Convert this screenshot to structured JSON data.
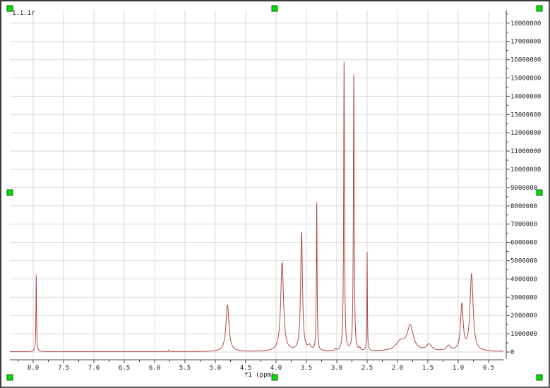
{
  "chart_data": {
    "type": "line",
    "title": "1.1.1r",
    "xlabel": "f1 (ppm)",
    "ylabel": "",
    "xlim": [
      8.38,
      0.26
    ],
    "ylim": [
      -400000,
      18600000
    ],
    "x_ticks": [
      "8.0",
      "7.5",
      "7.0",
      "6.5",
      "6.0",
      "5.5",
      "5.0",
      "4.5",
      "4.0",
      "3.5",
      "3.0",
      "2.5",
      "2.0",
      "1.5",
      "1.0",
      "0.5"
    ],
    "y_ticks": [
      "0",
      "1000000",
      "2000000",
      "3000000",
      "4000000",
      "5000000",
      "6000000",
      "7000000",
      "8000000",
      "9000000",
      "10000000",
      "11000000",
      "12000000",
      "13000000",
      "14000000",
      "15000000",
      "16000000",
      "17000000",
      "18000000"
    ],
    "grid": true,
    "line_color": "#b04848",
    "peaks": [
      {
        "ppm": 7.95,
        "height": 4200000,
        "width": 0.006
      },
      {
        "ppm": 5.77,
        "height": 80000,
        "width": 0.005
      },
      {
        "ppm": 4.8,
        "height": 2550000,
        "width": 0.03
      },
      {
        "ppm": 3.9,
        "height": 4850000,
        "width": 0.028
      },
      {
        "ppm": 3.58,
        "height": 6500000,
        "width": 0.018
      },
      {
        "ppm": 3.45,
        "height": 250000,
        "width": 0.03
      },
      {
        "ppm": 3.33,
        "height": 8100000,
        "width": 0.007
      },
      {
        "ppm": 3.02,
        "height": 100000,
        "width": 0.01
      },
      {
        "ppm": 2.88,
        "height": 15800000,
        "width": 0.008
      },
      {
        "ppm": 2.72,
        "height": 15100000,
        "width": 0.008
      },
      {
        "ppm": 2.62,
        "height": 150000,
        "width": 0.01
      },
      {
        "ppm": 2.5,
        "height": 5400000,
        "width": 0.005
      },
      {
        "ppm": 1.95,
        "height": 500000,
        "width": 0.09
      },
      {
        "ppm": 1.79,
        "height": 1350000,
        "width": 0.06
      },
      {
        "ppm": 1.48,
        "height": 350000,
        "width": 0.05
      },
      {
        "ppm": 1.16,
        "height": 280000,
        "width": 0.04
      },
      {
        "ppm": 0.94,
        "height": 2500000,
        "width": 0.025
      },
      {
        "ppm": 0.78,
        "height": 4200000,
        "width": 0.03
      }
    ]
  }
}
